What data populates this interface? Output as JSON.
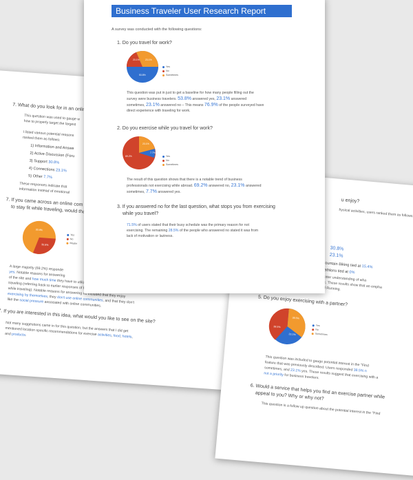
{
  "colors": {
    "blue": "#2f6fcf",
    "red": "#d0432b",
    "orange": "#f29a2e",
    "accent": "#3a78d4"
  },
  "left": {
    "q7": "7. What do you look for in an online",
    "p7a": "This question was used to gauge w",
    "p7b": "how to properly target the largest",
    "p7c": "I listed various potential reasons",
    "p7d": "ranked them as follows:",
    "items": [
      {
        "num": "1)",
        "text": "Information and Answe",
        "val": ""
      },
      {
        "num": "2)",
        "text": "Active Discussion (Foru",
        "val": ""
      },
      {
        "num": "3)",
        "text": "Support ",
        "val": "30.8%"
      },
      {
        "num": "4)",
        "text": "Connections ",
        "val": "23.1%"
      },
      {
        "num": "5)",
        "text": "Other ",
        "val": "7.7%"
      }
    ],
    "p7e": "These responses indicate that",
    "p7f": "information instead of emotional",
    "q8a": "7. If you came across an online com",
    "q8b": "to stay fit while traveling, would tha",
    "pie_labels": {
      "a": "30.8%",
      "b": "30.8%"
    },
    "legend": [
      "Yes",
      "No",
      "Maybe"
    ],
    "p8a_pre": "A large majority (69.2%) responde",
    "p8b": "yes.",
    "p8b2": " Notable reasons for answering",
    "p8c": "of the site and ",
    "p8c_blue": "how much time",
    "p8c_post": " they have to utilize a community like that while",
    "p8d": "traveling (referring back to earlier responses of business travelers having little time",
    "p8e": "while traveling). Notable reasons for answering no included that they enjoy",
    "p8f_blue": "exercising by themselves",
    "p8f_mid": ", they ",
    "p8f_blue2": "don't use online communities",
    "p8f_post": ", and that they don't",
    "p8g_pre": "like the ",
    "p8g_blue": "social pressure",
    "p8g_post": " associated with online communities.",
    "q9": "7. If you are interested in this idea, what would you like to see on the site?",
    "p9a": "Not many suggestions came in for this question, but the answers that I did get",
    "p9b_pre": "mentioned location specific recommendations for exercise ",
    "p9b_b1": "activities",
    "p9b_b2": "food",
    "p9b_b3": "hotels",
    "p9c_pre": "and ",
    "p9c_b": "products"
  },
  "right": {
    "q_top": "u enjoy?",
    "p_top": "hysical activities, users ranked them as follows:",
    "vals": [
      "30.8%",
      "23.1%"
    ],
    "mtb_pre": "Mountain Biking tied at ",
    "mtb_val": "15.4%",
    "tri_pre": "Triathlons tied at ",
    "tri_val": "0%",
    "pa": "ed to give you a better understanding of wha",
    "pb": "are popular with this demographic. These results show that an empha",
    "pc": "be placed on Hiking, Walking, and Running.",
    "q5": "5. Do you enjoy exercising with a partner?",
    "pie_labels": {
      "a": "38.5%",
      "b": "38.5%",
      "c": "23.1%"
    },
    "legend": [
      "Yes",
      "No",
      "Sometimes"
    ],
    "pd": "This question was included to gauge potential interest in the \"Find",
    "pe": "feature that was previously described. Users responded ",
    "pe_val": "38.5% n",
    "pf_pre": "sometimes, and ",
    "pf_val": "23.1%",
    "pf_post": " yes. These results suggest that exercising with a",
    "pg_blue": "not a priority",
    "pg_post": " for business travelers.",
    "q6a": "6. Would a service that helps you find an exercise partner while",
    "q6b": "appeal to you? Why or why not?",
    "ph": "This question is a follow up question about the potential interest in the \"Find"
  },
  "front": {
    "title": "Business Traveler User Research Report",
    "intro": "A survey was conducted with the following questions:",
    "q1": "1. Do you travel for work?",
    "pie1": {
      "a": "23.1%",
      "b": "23.1%",
      "c": "53.8%"
    },
    "legend1": [
      "Yes",
      "No",
      "Sometimes"
    ],
    "p1a": "This question was put in just to get a baseline for how many people filling out the",
    "p1b_pre": "survey were business travelers. ",
    "p1b_v1": "53.8%",
    "p1b_mid": " answered yes, ",
    "p1b_v2": "23.1%",
    "p1b_post": " answered",
    "p1c_pre": "sometimes, ",
    "p1c_v1": "23.1%",
    "p1c_mid": " answered no – This means ",
    "p1c_v2": "76.9%",
    "p1c_post": " of the people surveyed have",
    "p1d": "direct experience with traveling for work.",
    "q2": "2. Do you exercise while you travel for work?",
    "pie2": {
      "a": "23.1%",
      "b": "69.2%",
      "c": "7.7%"
    },
    "legend2": [
      "Yes",
      "No",
      "Sometimes"
    ],
    "p2a": "The result of this question shows that there is a notable trend of business",
    "p2b_pre": "professionals not exercising while abroad. ",
    "p2b_v1": "69.2%",
    "p2b_mid": " answered no, ",
    "p2b_v2": "23.1%",
    "p2b_post": " answered",
    "p2c_pre": "sometimes, ",
    "p2c_v1": "7.7%",
    "p2c_post": " answered yes.",
    "q3a": "3. If you answered no for the last question, what stops you from exercising",
    "q3b": "while you travel?",
    "p3a_v": "71.5%",
    "p3a_post": " of users stated that their busy schedule was the primary reason for not",
    "p3b_pre": "exercising. The remaining ",
    "p3b_v": "28.5%",
    "p3b_post": " of the people who answered no stated it was from",
    "p3c": "lack of motivation or laziness."
  }
}
